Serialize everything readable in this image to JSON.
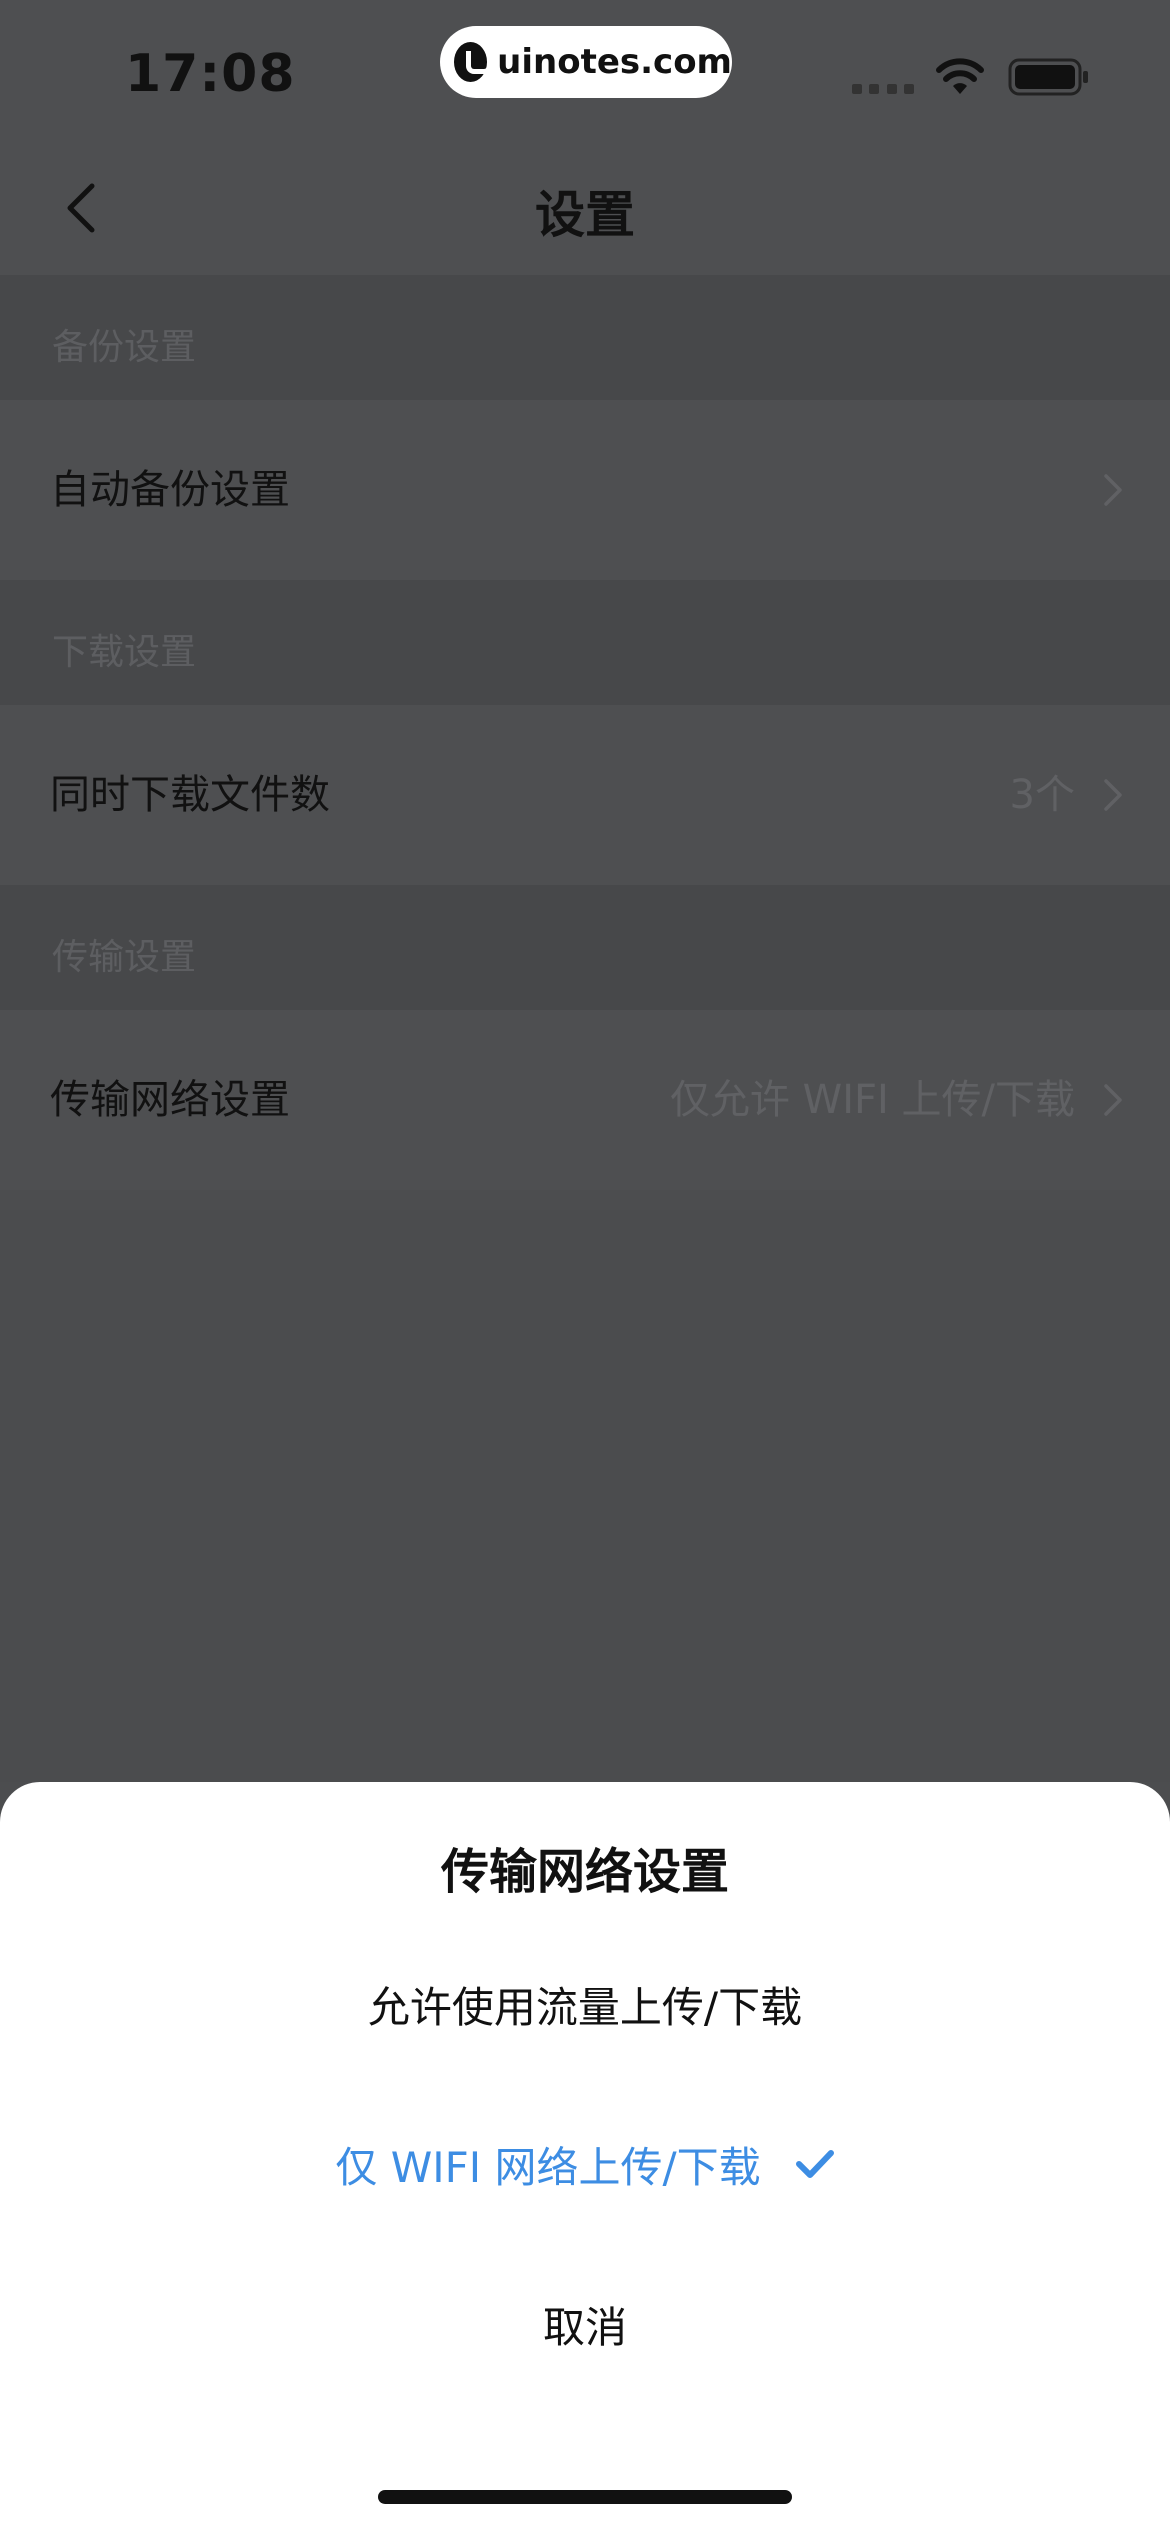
{
  "status_bar": {
    "time": "17:08",
    "watermark": "uinotes.com",
    "icons": [
      "signal-icon",
      "wifi-icon",
      "battery-icon"
    ]
  },
  "nav": {
    "title": "设置",
    "back_icon": "chevron-left-icon"
  },
  "sections": [
    {
      "header": "备份设置",
      "rows": [
        {
          "label": "自动备份设置",
          "value": ""
        }
      ]
    },
    {
      "header": "下载设置",
      "rows": [
        {
          "label": "同时下载文件数",
          "value": "3个"
        }
      ]
    },
    {
      "header": "传输设置",
      "rows": [
        {
          "label": "传输网络设置",
          "value": "仅允许 WIFI 上传/下载"
        }
      ]
    }
  ],
  "sheet": {
    "title": "传输网络设置",
    "options": [
      {
        "label": "允许使用流量上传/下载",
        "selected": false
      },
      {
        "label": "仅 WIFI 网络上传/下载",
        "selected": true
      }
    ],
    "cancel_label": "取消",
    "selected_color": "#3d8de3",
    "check_icon": "check-icon"
  }
}
